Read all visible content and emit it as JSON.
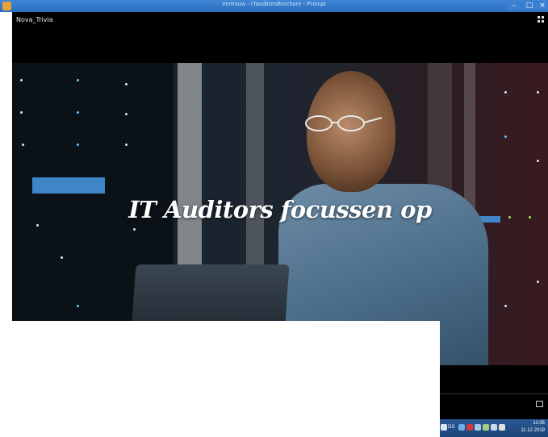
{
  "window": {
    "title": "Vertrouw - ITauditorsBrochure - Prompt"
  },
  "app": {
    "header_label": "Nova_Trivia",
    "grid_icon": "grid-icon"
  },
  "hero": {
    "heading": "IT Auditors focussen op"
  },
  "footer": {
    "corner_icon": "slide-icon"
  },
  "taskbar": {
    "lang": "DS",
    "time": "11:05",
    "date": "11 12 2019"
  },
  "colors": {
    "titlebar": "#2a6fc0",
    "app_bg": "#000000",
    "taskbar": "#1d4478"
  }
}
